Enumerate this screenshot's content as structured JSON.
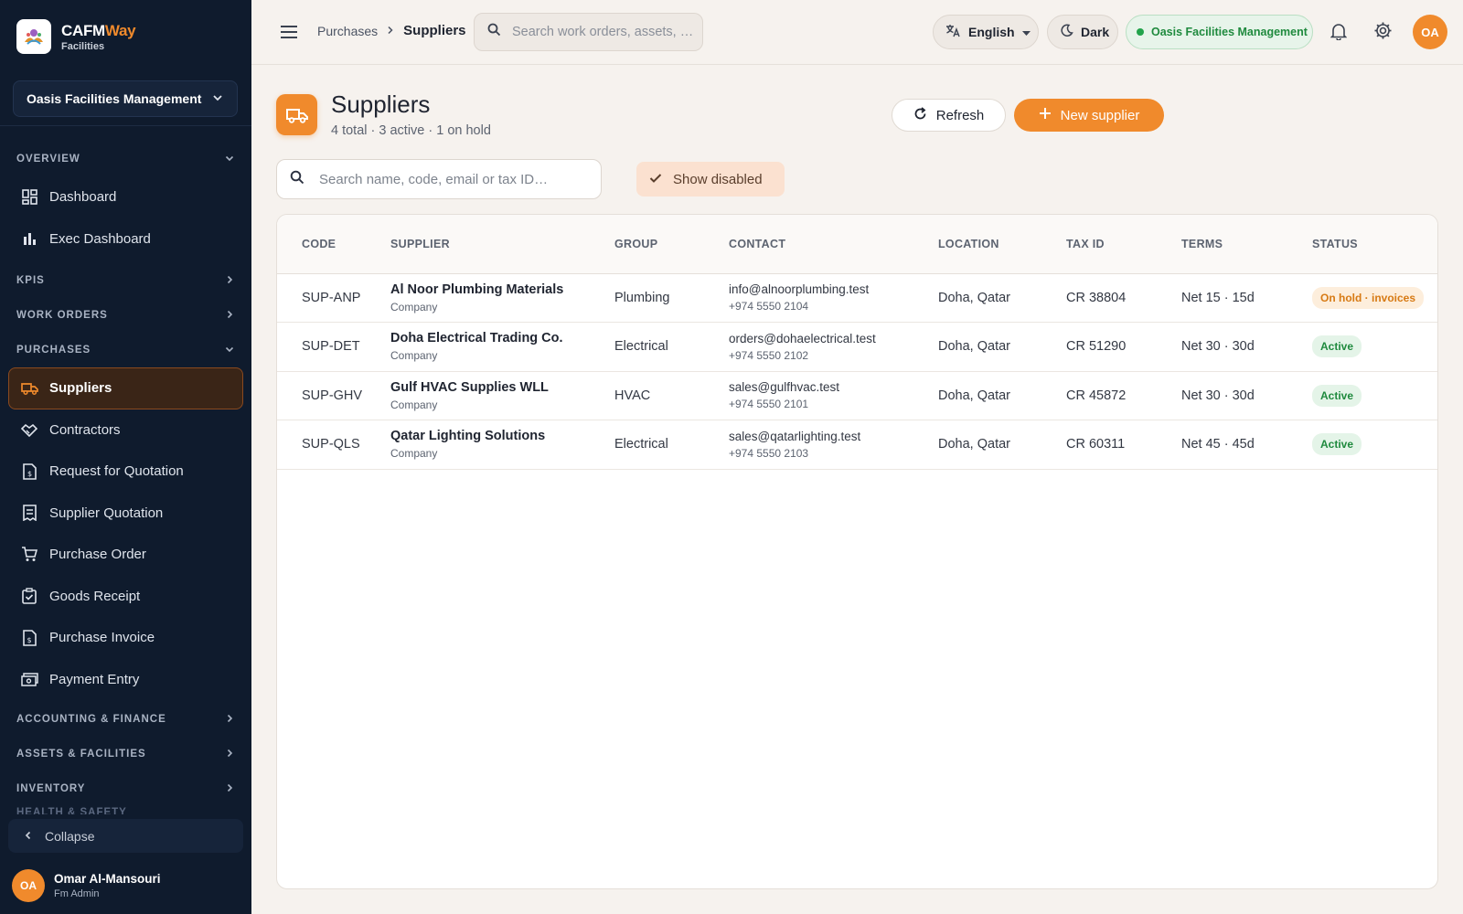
{
  "brand": {
    "name_main": "CAFM",
    "name_accent": "Way",
    "sub": "Facilities"
  },
  "sidebar": {
    "org": "Oasis Facilities Management",
    "sections": {
      "overview": "OVERVIEW",
      "kpis": "KPIS",
      "work_orders": "WORK ORDERS",
      "purchases": "PURCHASES",
      "accounting": "ACCOUNTING & FINANCE",
      "assets": "ASSETS & FACILITIES",
      "inventory": "INVENTORY",
      "health": "HEALTH & SAFETY"
    },
    "overview_items": [
      "Dashboard",
      "Exec Dashboard"
    ],
    "purchase_items": [
      "Suppliers",
      "Contractors",
      "Request for Quotation",
      "Supplier Quotation",
      "Purchase Order",
      "Goods Receipt",
      "Purchase Invoice",
      "Payment Entry"
    ],
    "collapse": "Collapse",
    "user": {
      "initials": "OA",
      "name": "Omar Al-Mansouri",
      "role": "Fm Admin"
    }
  },
  "topbar": {
    "breadcrumb_parent": "Purchases",
    "breadcrumb_current": "Suppliers",
    "search_placeholder": "Search work orders, assets, …",
    "language": "English",
    "theme": "Dark",
    "org": "Oasis Facilities Management",
    "avatar": "OA"
  },
  "page": {
    "title": "Suppliers",
    "subtitle": "4 total · 3 active · 1 on hold",
    "refresh": "Refresh",
    "new_supplier": "New supplier",
    "search_placeholder": "Search name, code, email or tax ID…",
    "show_disabled": "Show disabled"
  },
  "table": {
    "columns": [
      "CODE",
      "SUPPLIER",
      "GROUP",
      "CONTACT",
      "LOCATION",
      "TAX ID",
      "TERMS",
      "STATUS"
    ],
    "rows": [
      {
        "code": "SUP-ANP",
        "name": "Al Noor Plumbing Materials",
        "type": "Company",
        "group": "Plumbing",
        "email": "info@alnoorplumbing.test",
        "phone": "+974 5550 2104",
        "location": "Doha, Qatar",
        "tax": "CR 38804",
        "terms": "Net 15 · 15d",
        "status": "On hold · invoices"
      },
      {
        "code": "SUP-DET",
        "name": "Doha Electrical Trading Co.",
        "type": "Company",
        "group": "Electrical",
        "email": "orders@dohaelectrical.test",
        "phone": "+974 5550 2102",
        "location": "Doha, Qatar",
        "tax": "CR 51290",
        "terms": "Net 30 · 30d",
        "status": "Active"
      },
      {
        "code": "SUP-GHV",
        "name": "Gulf HVAC Supplies WLL",
        "type": "Company",
        "group": "HVAC",
        "email": "sales@gulfhvac.test",
        "phone": "+974 5550 2101",
        "location": "Doha, Qatar",
        "tax": "CR 45872",
        "terms": "Net 30 · 30d",
        "status": "Active"
      },
      {
        "code": "SUP-QLS",
        "name": "Qatar Lighting Solutions",
        "type": "Company",
        "group": "Electrical",
        "email": "sales@qatarlighting.test",
        "phone": "+974 5550 2103",
        "location": "Doha, Qatar",
        "tax": "CR 60311",
        "terms": "Net 45 · 45d",
        "status": "Active"
      }
    ]
  },
  "colors": {
    "accent": "#f08a2c",
    "sidebar_bg": "#0f1b2d",
    "active_green": "#1f8a3e",
    "hold_orange": "#d77a14"
  }
}
